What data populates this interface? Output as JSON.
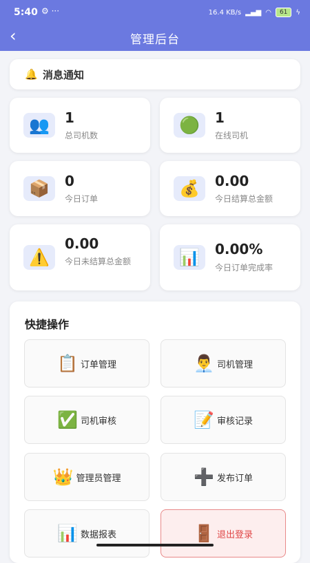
{
  "status_bar": {
    "time": "5:40",
    "net_speed": "16.4 KB/s",
    "battery": "61"
  },
  "nav": {
    "title": "管理后台",
    "back_glyph": "‹"
  },
  "notice": {
    "icon": "bell-icon",
    "glyph": "🔔",
    "text": "消息通知"
  },
  "stats": [
    {
      "value": "1",
      "label": "总司机数",
      "icon": "people-icon",
      "glyph": "👥"
    },
    {
      "value": "1",
      "label": "在线司机",
      "icon": "online-dot-icon",
      "glyph": "🟢"
    },
    {
      "value": "0",
      "label": "今日订单",
      "icon": "package-icon",
      "glyph": "📦"
    },
    {
      "value": "0.00",
      "label": "今日结算总金额",
      "icon": "money-bag-icon",
      "glyph": "💰"
    },
    {
      "value": "0.00",
      "label": "今日未结算总金额",
      "icon": "warning-icon",
      "glyph": "⚠️"
    },
    {
      "value": "0.00%",
      "label": "今日订单完成率",
      "icon": "bar-chart-icon",
      "glyph": "📊"
    }
  ],
  "quick": {
    "title": "快捷操作",
    "actions": [
      {
        "label": "订单管理",
        "icon": "clipboard-icon",
        "glyph": "📋"
      },
      {
        "label": "司机管理",
        "icon": "driver-icon",
        "glyph": "👨‍💼"
      },
      {
        "label": "司机审核",
        "icon": "check-icon",
        "glyph": "✅"
      },
      {
        "label": "审核记录",
        "icon": "memo-icon",
        "glyph": "📝"
      },
      {
        "label": "管理员管理",
        "icon": "crown-icon",
        "glyph": "👑"
      },
      {
        "label": "发布订单",
        "icon": "plus-icon",
        "glyph": "➕"
      },
      {
        "label": "数据报表",
        "icon": "bar-chart-icon",
        "glyph": "📊"
      },
      {
        "label": "退出登录",
        "icon": "door-icon",
        "glyph": "🚪"
      }
    ]
  }
}
